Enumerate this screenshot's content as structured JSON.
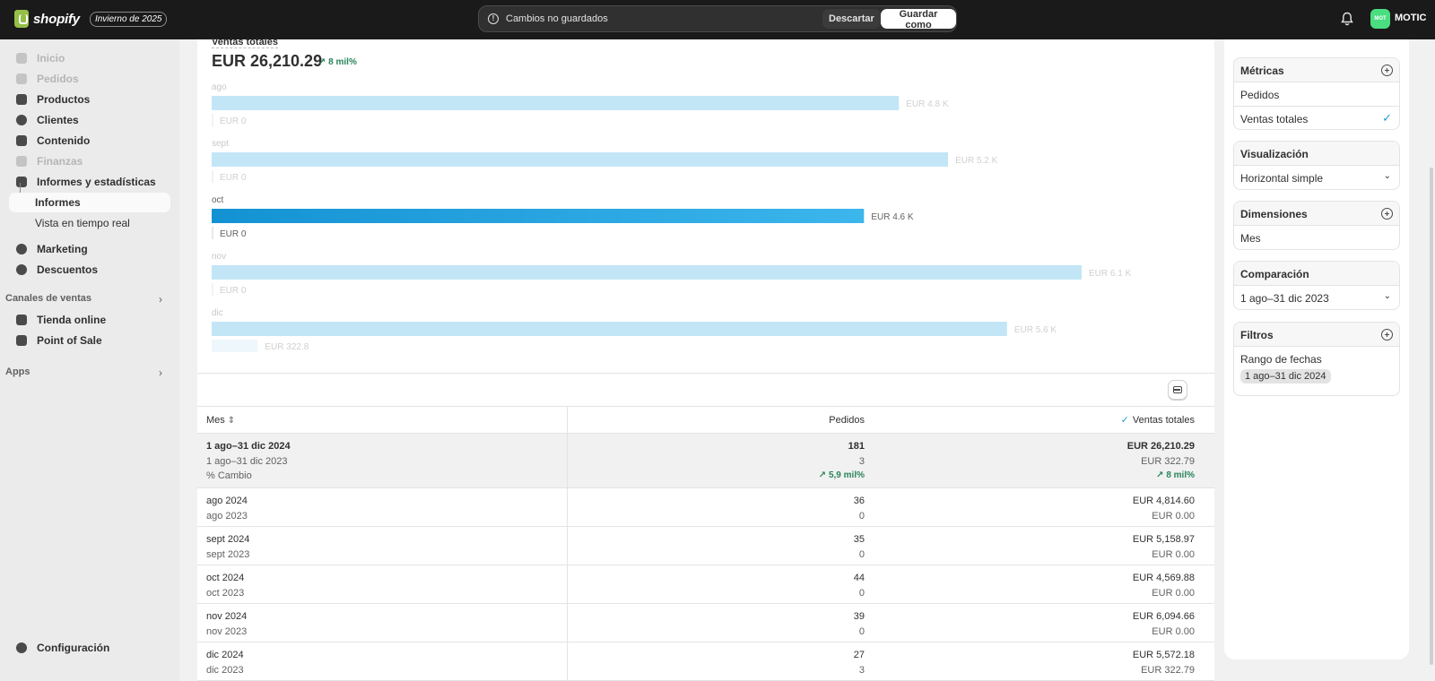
{
  "topbar": {
    "brand": "shopify",
    "edition": "Invierno de 2025",
    "unsaved_text": "Cambios no guardados",
    "discard_label": "Descartar",
    "save_label": "Guardar como",
    "avatar_initials": "MOT",
    "store_name": "MOTIC"
  },
  "sidebar": {
    "items": [
      {
        "label": "Inicio"
      },
      {
        "label": "Pedidos"
      },
      {
        "label": "Productos"
      },
      {
        "label": "Clientes"
      },
      {
        "label": "Contenido"
      },
      {
        "label": "Finanzas"
      },
      {
        "label": "Informes y estadísticas"
      }
    ],
    "sub_items": [
      {
        "label": "Informes"
      },
      {
        "label": "Vista en tiempo real"
      }
    ],
    "more_items": [
      {
        "label": "Marketing"
      },
      {
        "label": "Descuentos"
      }
    ],
    "sales_channels_label": "Canales de ventas",
    "channels": [
      {
        "label": "Tienda online"
      },
      {
        "label": "Point of Sale"
      }
    ],
    "apps_label": "Apps",
    "settings_label": "Configuración"
  },
  "chart_header": {
    "title": "Ventas totales",
    "total": "EUR 26,210.29",
    "change": "8 mil%"
  },
  "chart_data": {
    "type": "bar",
    "orientation": "horizontal",
    "categories": [
      "ago",
      "sept",
      "oct",
      "nov",
      "dic"
    ],
    "series": [
      {
        "name": "1 ago–31 dic 2024",
        "values": [
          4814.6,
          5158.97,
          4569.88,
          6094.66,
          5572.18
        ],
        "labels": [
          "EUR 4.8 K",
          "EUR 5.2 K",
          "EUR 4.6 K",
          "EUR 6.1 K",
          "EUR 5.6 K"
        ]
      },
      {
        "name": "1 ago–31 dic 2023",
        "values": [
          0,
          0,
          0,
          0,
          322.79
        ],
        "labels": [
          "EUR 0",
          "EUR 0",
          "EUR 0",
          "EUR 0",
          "EUR 322.8"
        ]
      }
    ],
    "highlighted_category": "oct",
    "colors": {
      "primary": "#1a9fdd",
      "faded": "#c3e6f7",
      "compare": "#eef7fb"
    }
  },
  "table": {
    "columns": {
      "mes": "Mes",
      "pedidos": "Pedidos",
      "ventas": "Ventas totales"
    },
    "summary": {
      "period_current": "1 ago–31 dic 2024",
      "period_previous": "1 ago–31 dic 2023",
      "change_label": "% Cambio",
      "pedidos_current": "181",
      "pedidos_previous": "3",
      "pedidos_change": "5,9 mil%",
      "ventas_current": "EUR 26,210.29",
      "ventas_previous": "EUR 322.79",
      "ventas_change": "8 mil%"
    },
    "rows": [
      {
        "mes": "ago 2024",
        "mes_prev": "ago 2023",
        "pedidos": "36",
        "pedidos_prev": "0",
        "ventas": "EUR 4,814.60",
        "ventas_prev": "EUR 0.00"
      },
      {
        "mes": "sept 2024",
        "mes_prev": "sept 2023",
        "pedidos": "35",
        "pedidos_prev": "0",
        "ventas": "EUR 5,158.97",
        "ventas_prev": "EUR 0.00"
      },
      {
        "mes": "oct 2024",
        "mes_prev": "oct 2023",
        "pedidos": "44",
        "pedidos_prev": "0",
        "ventas": "EUR 4,569.88",
        "ventas_prev": "EUR 0.00"
      },
      {
        "mes": "nov 2024",
        "mes_prev": "nov 2023",
        "pedidos": "39",
        "pedidos_prev": "0",
        "ventas": "EUR 6,094.66",
        "ventas_prev": "EUR 0.00"
      },
      {
        "mes": "dic 2024",
        "mes_prev": "dic 2023",
        "pedidos": "27",
        "pedidos_prev": "3",
        "ventas": "EUR 5,572.18",
        "ventas_prev": "EUR 322.79"
      }
    ]
  },
  "panel": {
    "metrics": {
      "title": "Métricas",
      "items": [
        "Pedidos",
        "Ventas totales"
      ],
      "selected": "Ventas totales"
    },
    "visualization": {
      "title": "Visualización",
      "value": "Horizontal simple"
    },
    "dimensions": {
      "title": "Dimensiones",
      "value": "Mes"
    },
    "comparison": {
      "title": "Comparación",
      "value": "1 ago–31 dic 2023"
    },
    "filters": {
      "title": "Filtros",
      "label": "Rango de fechas",
      "tag": "1 ago–31 dic 2024"
    }
  }
}
